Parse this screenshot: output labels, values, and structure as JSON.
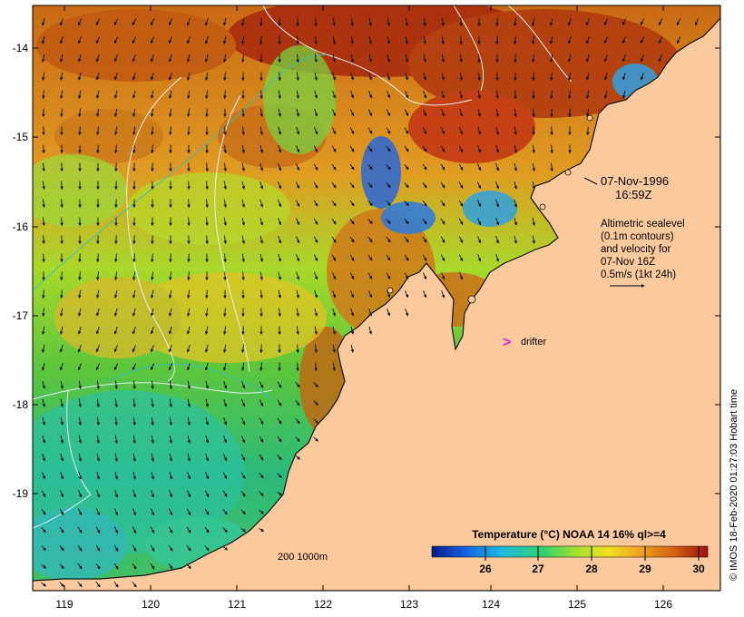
{
  "map": {
    "date_label": "07-Nov-1996",
    "time_label": "16:59Z",
    "legend_lines": [
      "Altimetric sealevel",
      "(0.1m contours)",
      "and velocity for",
      "07-Nov 16Z",
      "0.5m/s (1kt 24h)"
    ],
    "drifter_symbol": ">",
    "drifter_label": "drifter",
    "scale_label": "200  1000m",
    "lat_ticks": [
      "-14",
      "-15",
      "-16",
      "-17",
      "-18",
      "-19"
    ],
    "lon_ticks": [
      "119",
      "120",
      "121",
      "122",
      "123",
      "124",
      "125",
      "126"
    ],
    "credit": "© IMOS 18-Feb-2020 01:27:03 Hobart time"
  },
  "colorbar": {
    "title": "Temperature (°C) NOAA 14 16% ql>=4",
    "ticks": [
      "26",
      "27",
      "28",
      "29",
      "30"
    ],
    "colors": [
      "#0a1a8a",
      "#1060e0",
      "#20b8e0",
      "#30d070",
      "#a0e030",
      "#f0e020",
      "#f0a020",
      "#d06010",
      "#a01010"
    ]
  },
  "colors": {
    "land": "#fcc99c",
    "drifter": "#e020e0",
    "contour": "#e8eef6",
    "isobath": "#30c0c0"
  }
}
